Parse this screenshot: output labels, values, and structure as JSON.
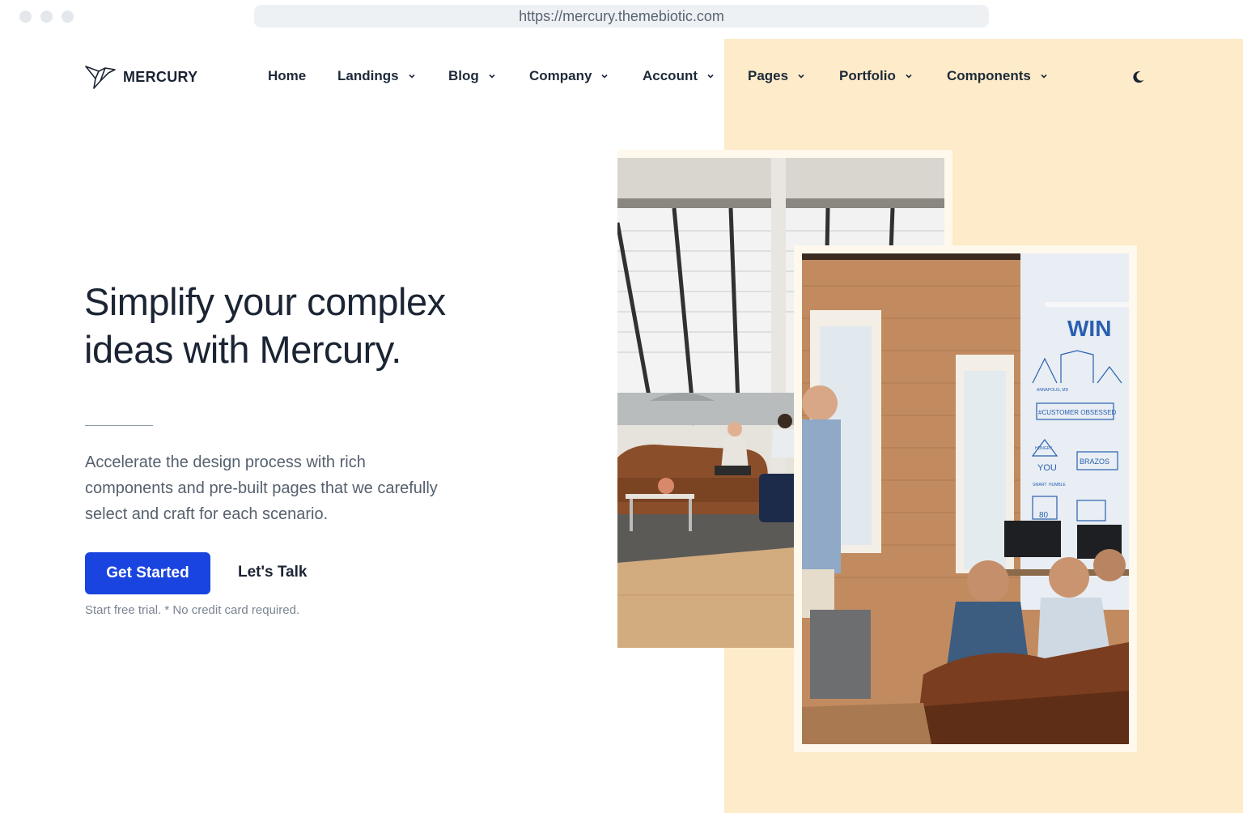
{
  "browser": {
    "url": "https://mercury.themebiotic.com"
  },
  "brand": {
    "name": "MERCURY",
    "logo_icon": "bird-logo-icon"
  },
  "nav": {
    "items": [
      {
        "label": "Home",
        "has_dropdown": false
      },
      {
        "label": "Landings",
        "has_dropdown": true
      },
      {
        "label": "Blog",
        "has_dropdown": true
      },
      {
        "label": "Company",
        "has_dropdown": true
      },
      {
        "label": "Account",
        "has_dropdown": true
      },
      {
        "label": "Pages",
        "has_dropdown": true
      },
      {
        "label": "Portfolio",
        "has_dropdown": true
      },
      {
        "label": "Components",
        "has_dropdown": true
      }
    ],
    "theme_toggle_icon": "moon-icon"
  },
  "hero": {
    "headline_line1": "Simplify your complex",
    "headline_line2": "ideas with Mercury.",
    "lead_line1": "Accelerate the design process with rich",
    "lead_line2": "components and pre-built pages that we carefully",
    "lead_line3": "select and craft for each scenario.",
    "primary_button": "Get Started",
    "secondary_button": "Let's Talk",
    "note": "Start free trial. * No credit card required."
  },
  "images": {
    "back_photo": "office lounge with large slanted windows",
    "front_photo": "team meeting in brick-walled office"
  },
  "mural": {
    "win": "WIN",
    "customer": "#CUSTOMER OBSESSED",
    "you": "YOU",
    "brazos": "BRAZOS",
    "number": "80",
    "hungry": "HUNGRY",
    "smart": "SMART",
    "humble": "HUMBLE",
    "annapolis": "ANNAPOLIS, MD"
  },
  "colors": {
    "accent": "#1a44e0",
    "panel": "#fdebc9",
    "text": "#1b2433",
    "muted": "#56606e"
  }
}
